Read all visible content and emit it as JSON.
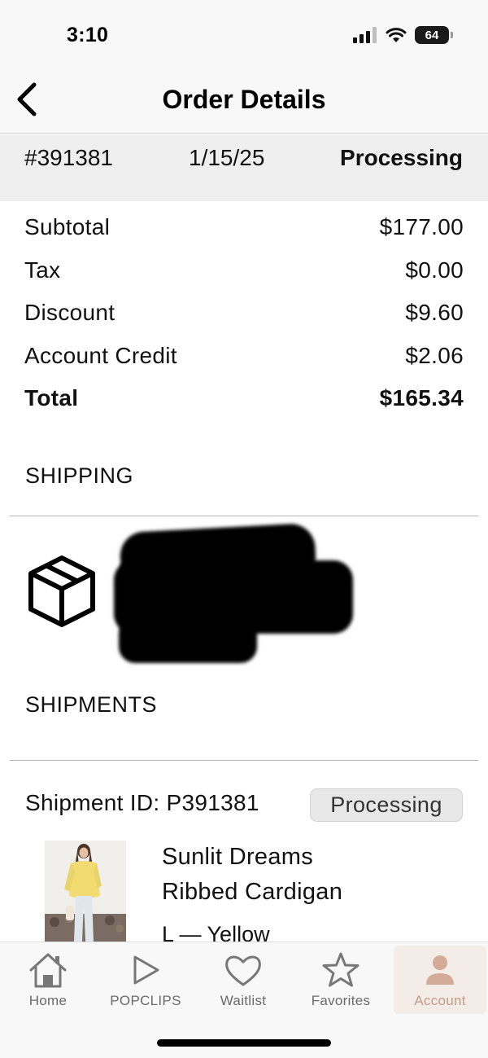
{
  "status_bar": {
    "time": "3:10",
    "battery": "64"
  },
  "header": {
    "title": "Order Details"
  },
  "order": {
    "number": "#391381",
    "date": "1/15/25",
    "status": "Processing"
  },
  "totals": {
    "subtotal_label": "Subtotal",
    "subtotal_value": "$177.00",
    "tax_label": "Tax",
    "tax_value": "$0.00",
    "discount_label": "Discount",
    "discount_value": "$9.60",
    "credit_label": "Account Credit",
    "credit_value": "$2.06",
    "total_label": "Total",
    "total_value": "$165.34"
  },
  "shipping": {
    "heading": "SHIPPING",
    "icon": "package-box-icon"
  },
  "shipments": {
    "heading": "SHIPMENTS",
    "shipment_id": "Shipment ID: P391381",
    "status": "Processing",
    "item": {
      "name_line1": "Sunlit Dreams",
      "name_line2": "Ribbed Cardigan",
      "variant": "L — Yellow"
    }
  },
  "tab_bar": {
    "tabs": [
      {
        "label": "Home",
        "icon": "home-icon"
      },
      {
        "label": "POPCLIPS",
        "icon": "play-icon"
      },
      {
        "label": "Waitlist",
        "icon": "heart-icon"
      },
      {
        "label": "Favorites",
        "icon": "star-icon"
      },
      {
        "label": "Account",
        "icon": "user-icon"
      }
    ],
    "active": "Account",
    "active_color": "#c49a88"
  }
}
